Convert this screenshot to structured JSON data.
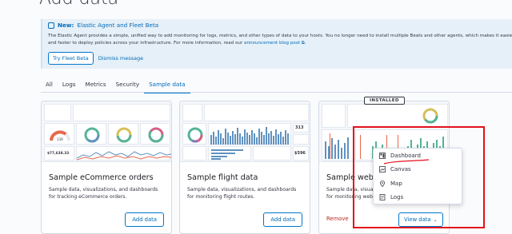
{
  "page": {
    "title": "Add data"
  },
  "callout": {
    "badge": "New:",
    "heading": "Elastic Agent and Fleet Beta",
    "body": "The Elastic Agent provides a simple, unified way to add monitoring for logs, metrics, and other types of data to your hosts. You no longer need to install multiple Beats and other agents, which makes it easier and faster to deploy policies across your infrastructure. For more information, read our",
    "link": "announcement blog post",
    "try_button": "Try Fleet Beta",
    "dismiss_button": "Dismiss message"
  },
  "tabs": [
    {
      "label": "All",
      "active": false
    },
    {
      "label": "Logs",
      "active": false
    },
    {
      "label": "Metrics",
      "active": false
    },
    {
      "label": "Security",
      "active": false
    },
    {
      "label": "Sample data",
      "active": true
    }
  ],
  "cards": [
    {
      "title": "Sample eCommerce orders",
      "description": "Sample data, visualizations, and dashboards for tracking eCommerce orders.",
      "button": "Add data",
      "thumb_values": {
        "gauge": "139",
        "metric": "$77,638.33"
      }
    },
    {
      "title": "Sample flight data",
      "description": "Sample data, visualizations, and dashboards for monitoring flight routes.",
      "button": "Add data",
      "thumb_values": {
        "metric_a": "313",
        "metric_b": "$596"
      }
    },
    {
      "title": "Sample web logs",
      "description": "Sample data, visualizations, and dashboards for monitoring web logs.",
      "remove": "Remove",
      "view_button": "View data",
      "badge": "INSTALLED"
    }
  ],
  "view_menu": [
    {
      "label": "Dashboard",
      "icon": "dashboard-icon"
    },
    {
      "label": "Canvas",
      "icon": "canvas-icon"
    },
    {
      "label": "Map",
      "icon": "map-icon"
    },
    {
      "label": "Logs",
      "icon": "logs-icon"
    }
  ],
  "colors": {
    "accent": "#0077cc",
    "annotation_red": "#e4101c",
    "remove_red": "#bd271e",
    "callout_bg": "#e6f0f8"
  }
}
